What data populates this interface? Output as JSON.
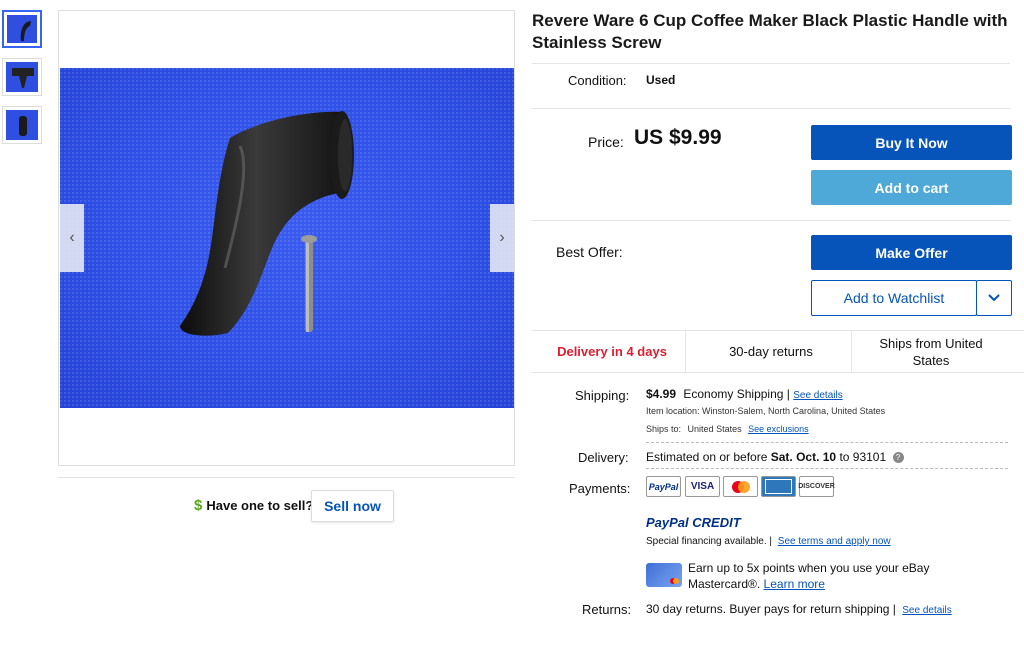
{
  "product": {
    "title": "Revere Ware 6 Cup Coffee Maker Black Plastic Handle with Stainless Screw",
    "condition_label": "Condition:",
    "condition_value": "Used",
    "price_label": "Price:",
    "price_value": "US $9.99",
    "best_offer_label": "Best Offer:"
  },
  "buttons": {
    "buy_now": "Buy It Now",
    "add_to_cart": "Add to cart",
    "make_offer": "Make Offer",
    "add_watchlist": "Add to Watchlist",
    "sell_now": "Sell now"
  },
  "highlights": {
    "delivery": "Delivery in 4 days",
    "returns": "30-day returns",
    "ships_from": "Ships from United States"
  },
  "shipping": {
    "label": "Shipping:",
    "cost": "$4.99",
    "method": "Economy Shipping |",
    "details_link": "See details",
    "location": "Item location:  Winston-Salem, North Carolina, United States",
    "ships_to_label": "Ships to:",
    "ships_to_value": "United States",
    "exclusions_link": "See exclusions"
  },
  "delivery": {
    "label": "Delivery:",
    "text_prefix": "Estimated on or before ",
    "date": "Sat. Oct. 10",
    "text_suffix": " to 93101"
  },
  "payments": {
    "label": "Payments:",
    "cards": [
      "PayPal",
      "VISA",
      "MasterCard",
      "AMEX",
      "DISCOVER"
    ],
    "paypal_credit": "PayPal CREDIT",
    "financing": "Special financing available.  |",
    "financing_link": "See terms and apply now",
    "mastercard_promo_line1": "Earn up to 5x points when you use your eBay",
    "mastercard_promo_line2": "Mastercard®.",
    "learn_more": "Learn more"
  },
  "returns": {
    "label": "Returns:",
    "text": "30 day returns. Buyer pays for return shipping |",
    "details_link": "See details"
  },
  "sell": {
    "prompt": "Have one to sell?",
    "dollar_icon": "$"
  },
  "colors": {
    "primary": "#0654ba",
    "secondary": "#4ea9d8",
    "delivery_red": "#dd1e31",
    "photo_bg": "#2d4fe6"
  }
}
